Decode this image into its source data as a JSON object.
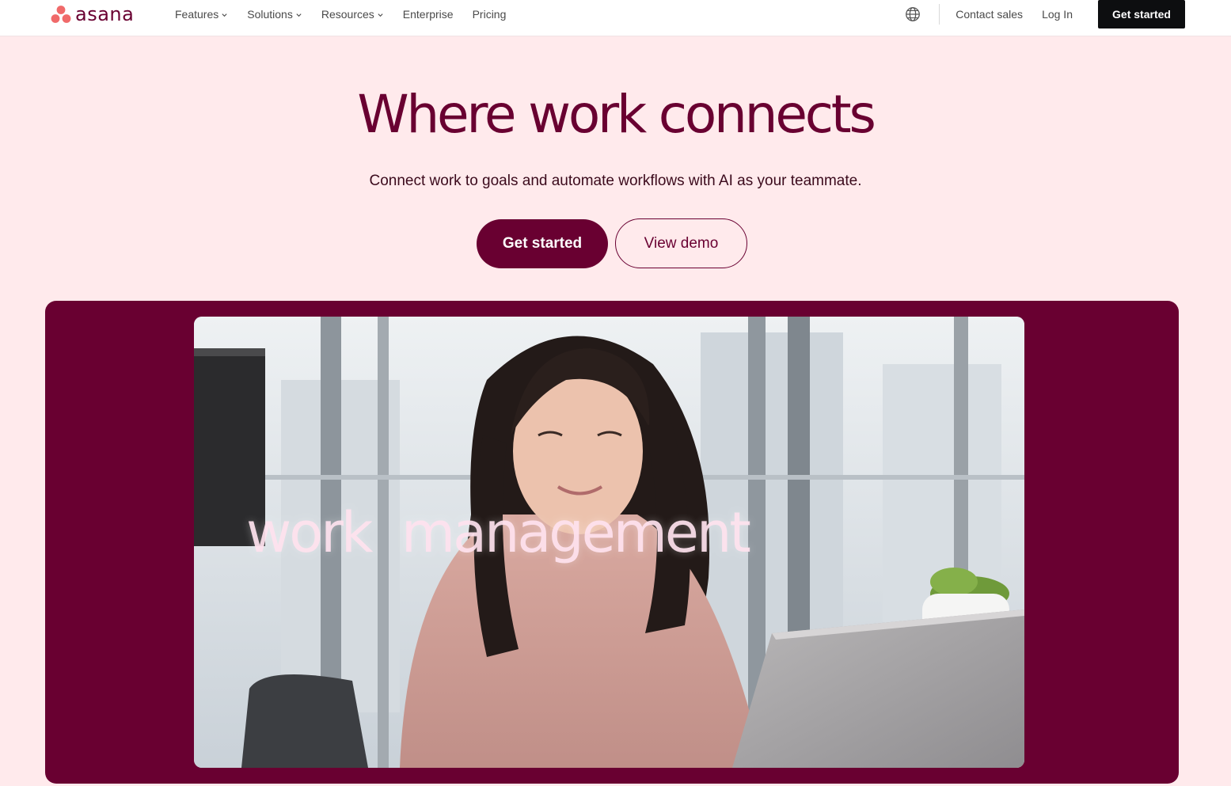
{
  "brand": {
    "name": "asana",
    "primary_color": "#690031",
    "logo_dot_color": "#f06a6a",
    "background_color": "#ffeaec"
  },
  "nav": {
    "links": [
      {
        "label": "Features",
        "has_dropdown": true
      },
      {
        "label": "Solutions",
        "has_dropdown": true
      },
      {
        "label": "Resources",
        "has_dropdown": true
      },
      {
        "label": "Enterprise",
        "has_dropdown": false
      },
      {
        "label": "Pricing",
        "has_dropdown": false
      }
    ],
    "globe_icon": "globe-icon",
    "contact_sales": "Contact sales",
    "login": "Log In",
    "cta": "Get started"
  },
  "hero": {
    "title": "Where work connects",
    "subtitle": "Connect work to goals and automate workflows with AI as your teammate.",
    "primary_cta": "Get started",
    "secondary_cta": "View demo"
  },
  "video": {
    "overlay_text": "work  management"
  }
}
